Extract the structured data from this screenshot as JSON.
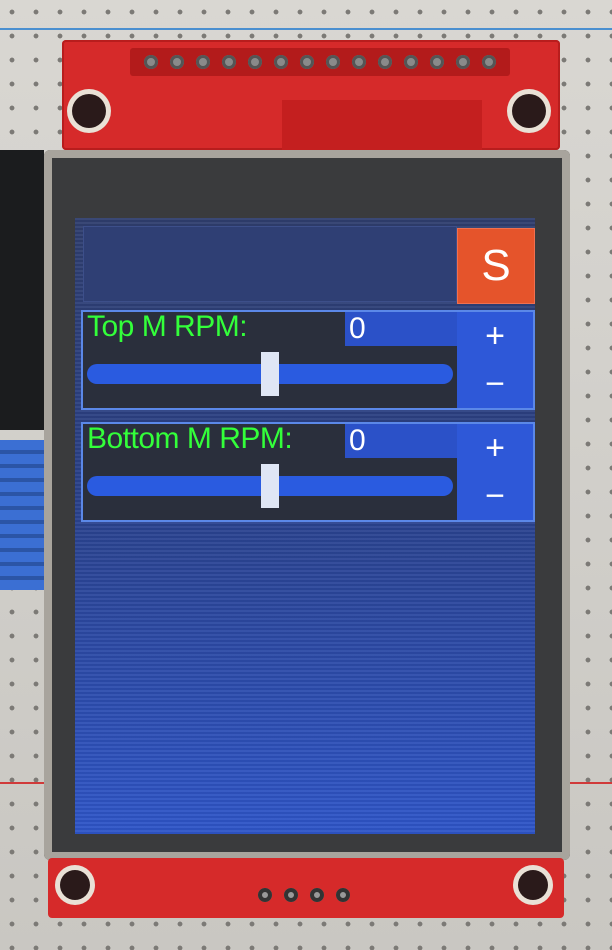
{
  "toolbar": {
    "s_button_label": "S"
  },
  "panels": [
    {
      "label": "Top M RPM:",
      "value": "0",
      "plus": "+",
      "minus": "−",
      "slider_position": 0.5
    },
    {
      "label": "Bottom M RPM:",
      "value": "0",
      "plus": "+",
      "minus": "−",
      "slider_position": 0.5
    }
  ],
  "colors": {
    "label": "#33ff3a",
    "accent": "#e5542b",
    "screen": "#2a418a"
  }
}
